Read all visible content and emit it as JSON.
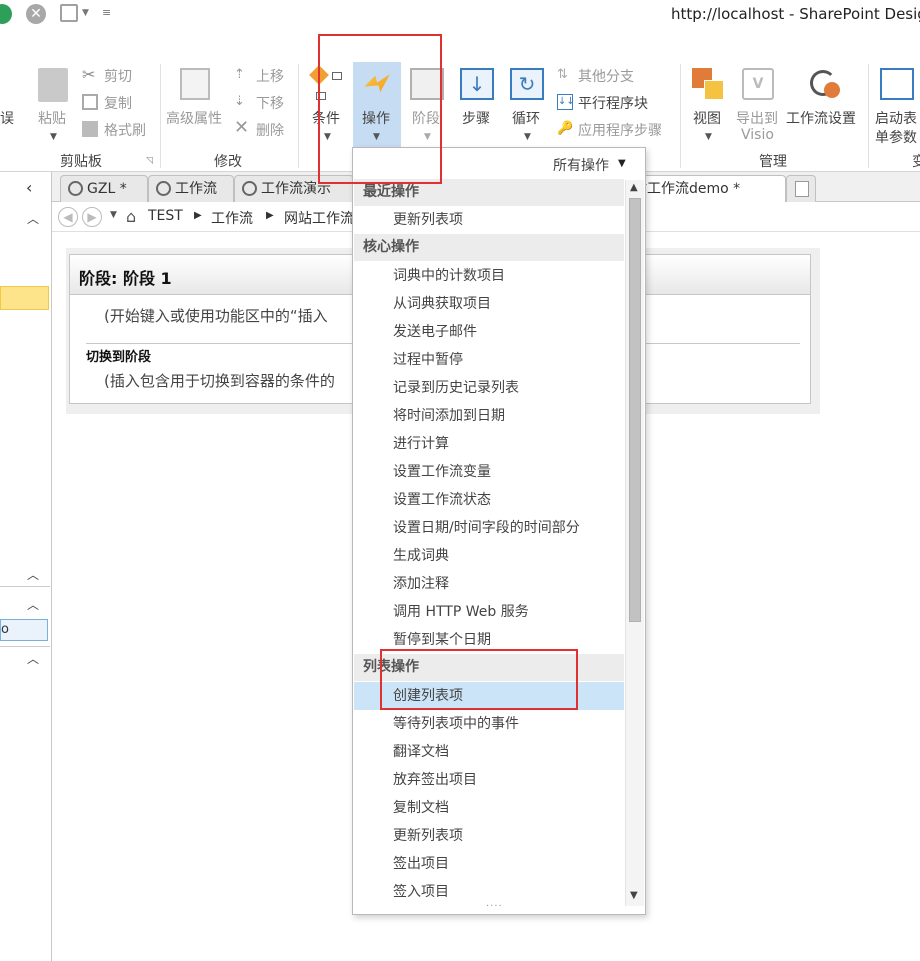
{
  "window": {
    "title": "http://localhost - SharePoint Desig"
  },
  "ribbon": {
    "left_cut_label": "误",
    "clipboard": {
      "paste": "粘贴",
      "cut": "剪切",
      "copy": "复制",
      "format_painter": "格式刷",
      "group_label": "剪贴板"
    },
    "modify": {
      "advanced_properties": "高级属性",
      "move_up": "上移",
      "move_down": "下移",
      "delete": "删除",
      "group_label": "修改"
    },
    "insert": {
      "condition": "条件",
      "action": "操作",
      "stage": "阶段",
      "step": "步骤",
      "loop": "循环",
      "other_branch": "其他分支",
      "parallel_block": "平行程序块",
      "app_step": "应用程序步骤"
    },
    "manage": {
      "view": "视图",
      "export_visio_1": "导出到",
      "export_visio_2": "Visio",
      "workflow_settings": "工作流设置",
      "group_label": "管理"
    },
    "start_options_1": "启动表",
    "start_options_2": "单参数",
    "right_cut_label": "变"
  },
  "tabs": [
    {
      "label": "GZL *"
    },
    {
      "label": "工作流"
    },
    {
      "label": "工作流演示"
    },
    {
      "label": "网站工作流demo *"
    }
  ],
  "breadcrumb": {
    "items": [
      "TEST",
      "工作流",
      "网站工作流"
    ]
  },
  "stage": {
    "title": "阶段: 阶段 1",
    "hint": "(开始键入或使用功能区中的“插入",
    "transition_title": "切换到阶段",
    "transition_hint": "(插入包含用于切换到容器的条件的"
  },
  "dropdown": {
    "all_actions": "所有操作",
    "sections": [
      {
        "header": "最近操作",
        "items": [
          "更新列表项"
        ]
      },
      {
        "header": "核心操作",
        "items": [
          "词典中的计数项目",
          "从词典获取项目",
          "发送电子邮件",
          "过程中暂停",
          "记录到历史记录列表",
          "将时间添加到日期",
          "进行计算",
          "设置工作流变量",
          "设置工作流状态",
          "设置日期/时间字段的时间部分",
          "生成词典",
          "添加注释",
          "调用 HTTP Web 服务",
          "暂停到某个日期"
        ]
      },
      {
        "header": "列表操作",
        "items": [
          "创建列表项",
          "等待列表项中的事件",
          "翻译文档",
          "放弃签出项目",
          "复制文档",
          "更新列表项",
          "签出项目",
          "签入项目"
        ]
      }
    ],
    "highlighted": "创建列表项",
    "more_indicator": "····"
  },
  "colors": {
    "highlight": "#cce4f7",
    "annotation_red": "#e03131",
    "ribbon_active": "#c5dcf2"
  }
}
